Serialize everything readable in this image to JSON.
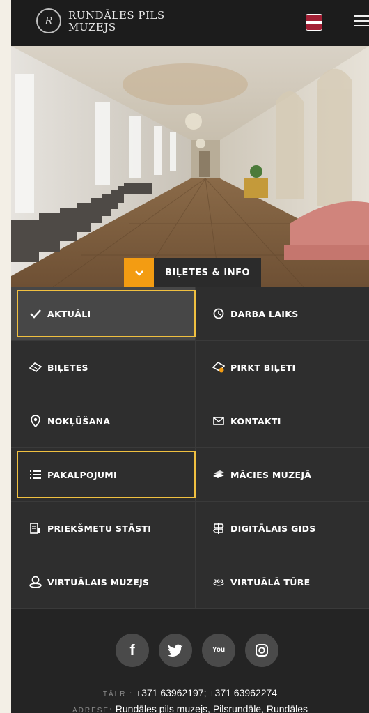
{
  "header": {
    "logo_monogram": "R",
    "logo_line1": "RUNDĀLES PILS",
    "logo_line2": "MUZEJS",
    "language_flag": "latvian-flag",
    "menu_icon": "hamburger-icon"
  },
  "hero": {
    "tickets_label": "BIĻETES & INFO",
    "toggle_icon": "chevron-down-icon"
  },
  "menu": {
    "items": [
      {
        "label": "AKTUĀLI",
        "icon": "check-icon",
        "highlighted": true
      },
      {
        "label": "DARBA LAIKS",
        "icon": "clock-icon"
      },
      {
        "label": "BIĻETES",
        "icon": "ticket-icon"
      },
      {
        "label": "PIRKT BIĻETI",
        "icon": "ticket-plus-icon"
      },
      {
        "label": "NOKĻŪŠANA",
        "icon": "location-pin-icon"
      },
      {
        "label": "KONTAKTI",
        "icon": "envelope-icon"
      },
      {
        "label": "PAKALPOJUMI",
        "icon": "list-icon",
        "highlighted": true
      },
      {
        "label": "MĀCIES MUZEJĀ",
        "icon": "books-icon"
      },
      {
        "label": "PRIEKŠMETU STĀSTI",
        "icon": "document-icon"
      },
      {
        "label": "DIGITĀLAIS GIDS",
        "icon": "signpost-icon"
      },
      {
        "label": "VIRTUĀLAIS MUZEJS",
        "icon": "vr-person-icon"
      },
      {
        "label": "VIRTUĀLĀ TŪRE",
        "icon": "360-icon"
      }
    ]
  },
  "footer": {
    "socials": [
      {
        "name": "facebook-icon",
        "glyph": "f"
      },
      {
        "name": "twitter-icon",
        "glyph": "t"
      },
      {
        "name": "youtube-icon",
        "glyph": "You"
      },
      {
        "name": "instagram-icon",
        "glyph": "◎"
      }
    ],
    "phone_label": "TĀLR.:",
    "phone_value": "+371 63962197; +371 63962274",
    "address_label": "ADRESE:",
    "address_value": "Rundāles pils muzejs, Pilsrundāle, Rundāles"
  },
  "colors": {
    "accent": "#f39c12",
    "highlight_border": "#f0c040",
    "menu_bg": "#2e2e2e",
    "header_bg": "#1c1c1c"
  }
}
